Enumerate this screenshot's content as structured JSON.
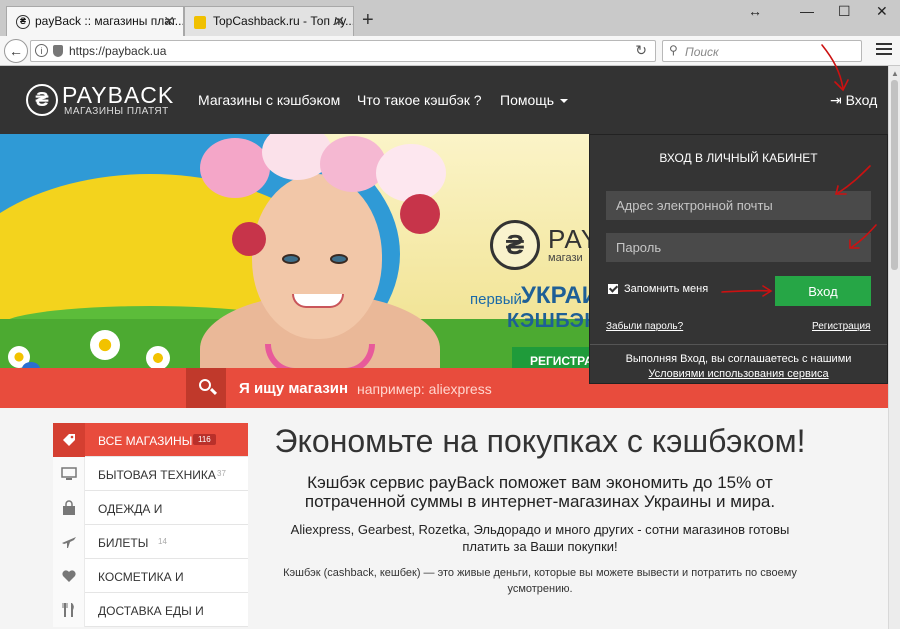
{
  "browser": {
    "tabs": [
      {
        "title": "payBack :: магазины плат...",
        "active": true
      },
      {
        "title": "TopCashback.ru - Топ лу...",
        "active": false
      }
    ],
    "address": "https://payback.ua",
    "search_placeholder": "Поиск"
  },
  "nav": {
    "logo_title": "PAYBACK",
    "logo_subtitle": "МАГАЗИНЫ ПЛАТЯТ",
    "links": [
      "Магазины с кэшбэком",
      "Что такое кэшбэк ?",
      "Помощь"
    ],
    "login_label": "Вход"
  },
  "hero": {
    "promo_brand": "PAYB",
    "promo_sub": "магази",
    "promo_first": "первый",
    "promo_country": "УКРАИ",
    "promo_cashback": "КЭШБЭК С",
    "promo_button": "РЕГИСТРА",
    "slides": 7,
    "active_slide": 1
  },
  "searchbar": {
    "label": "Я ищу магазин",
    "hint": "например: aliexpress"
  },
  "login_panel": {
    "title": "ВХОД В ЛИЧНЫЙ КАБИНЕТ",
    "email_placeholder": "Адрес электронной почты",
    "password_placeholder": "Пароль",
    "remember_label": "Запомнить меня",
    "remember_checked": true,
    "submit_label": "Вход",
    "forgot_label": "Забыли пароль?",
    "register_label": "Регистрация",
    "terms_line1": "Выполняя Вход, вы соглашаетесь с нашими",
    "terms_line2": "Условиями использования сервиса"
  },
  "categories": [
    {
      "label": "ВСЕ МАГАЗИНЫ",
      "count": "116",
      "icon": "tag-icon",
      "active": true
    },
    {
      "label": "БЫТОВАЯ ТЕХНИКА",
      "count": "37",
      "icon": "monitor-icon",
      "active": false
    },
    {
      "label": "ОДЕЖДА И",
      "count": "",
      "icon": "bag-icon",
      "active": false
    },
    {
      "label": "БИЛЕТЫ",
      "count": "14",
      "icon": "plane-icon",
      "active": false
    },
    {
      "label": "КОСМЕТИКА И",
      "count": "",
      "icon": "heart-icon",
      "active": false
    },
    {
      "label": "ДОСТАВКА ЕДЫ И",
      "count": "",
      "icon": "cutlery-icon",
      "active": false
    }
  ],
  "main": {
    "headline": "Экономьте на покупках с кэшбэком!",
    "lead": "Кэшбэк сервис payBack поможет вам экономить до 15% от потраченной суммы в интернет-магазинах Украины и мира.",
    "paragraph": "Aliexpress, Gearbest, Rozetka, Эльдорадо и много других - сотни магазинов готовы платить за Ваши покупки!",
    "note": "Кэшбэк (cashback, кешбек) — это живые деньги, которые вы можете вывести и потратить по своему усмотрению."
  },
  "colors": {
    "nav_bg": "#333333",
    "accent_red": "#e84c3d",
    "login_green": "#26a646",
    "annotation_red": "#cc1111"
  }
}
